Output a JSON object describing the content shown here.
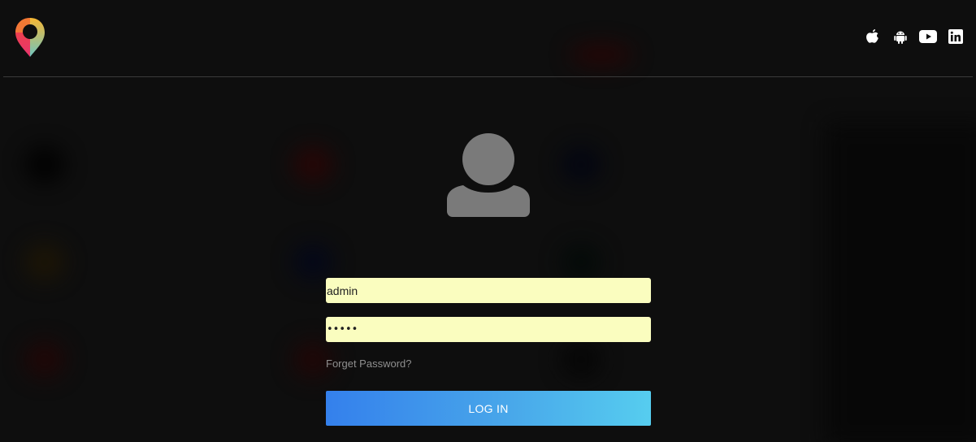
{
  "header": {
    "logo_icon": "map-pin-logo",
    "social_icons": [
      "apple-icon",
      "android-icon",
      "youtube-icon",
      "linkedin-icon"
    ]
  },
  "login": {
    "avatar_icon": "user-avatar-icon",
    "username_value": "admin",
    "password_value": "•••••",
    "forgot_password_label": "Forget Password?",
    "login_button_label": "LOG IN"
  },
  "colors": {
    "background": "#0e0e0e",
    "input_background": "#fafdbf",
    "button_gradient_start": "#3480ec",
    "button_gradient_end": "#56cdef",
    "avatar": "#7a7a7a",
    "link": "#8f8f8f"
  }
}
